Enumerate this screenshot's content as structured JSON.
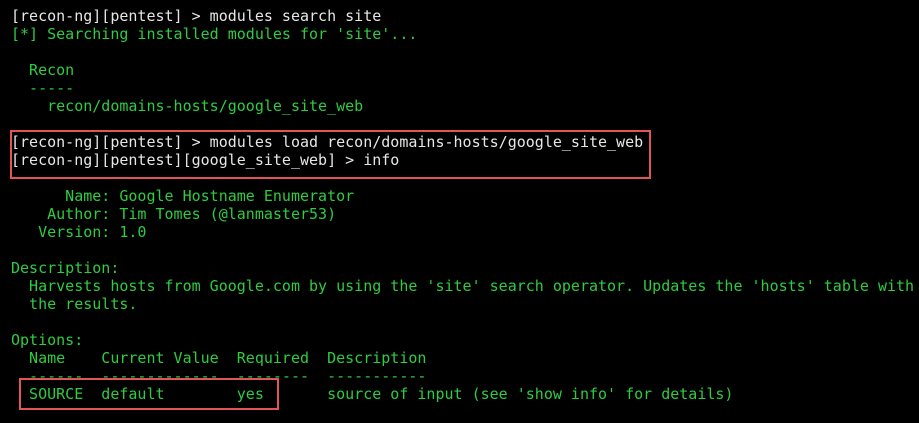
{
  "terminal": {
    "lines": [
      {
        "text": "[recon-ng][pentest] > modules search site",
        "style": "white"
      },
      {
        "text": "[*] Searching installed modules for 'site'...",
        "style": "green"
      },
      {
        "text": "",
        "style": "green"
      },
      {
        "text": "  Recon",
        "style": "green"
      },
      {
        "text": "  -----",
        "style": "green"
      },
      {
        "text": "    recon/domains-hosts/google_site_web",
        "style": "green"
      },
      {
        "text": "",
        "style": "green"
      },
      {
        "text": "[recon-ng][pentest] > modules load recon/domains-hosts/google_site_web",
        "style": "white"
      },
      {
        "text": "[recon-ng][pentest][google_site_web] > info",
        "style": "white"
      },
      {
        "text": "",
        "style": "green"
      },
      {
        "text": "      Name: Google Hostname Enumerator",
        "style": "green"
      },
      {
        "text": "    Author: Tim Tomes (@lanmaster53)",
        "style": "green"
      },
      {
        "text": "   Version: 1.0",
        "style": "green"
      },
      {
        "text": "",
        "style": "green"
      },
      {
        "text": "Description:",
        "style": "green"
      },
      {
        "text": "  Harvests hosts from Google.com by using the 'site' search operator. Updates the 'hosts' table with",
        "style": "green"
      },
      {
        "text": "  the results.",
        "style": "green"
      },
      {
        "text": "",
        "style": "green"
      },
      {
        "text": "Options:",
        "style": "green"
      },
      {
        "text": "  Name    Current Value  Required  Description",
        "style": "green"
      },
      {
        "text": "  ------  -------------  --------  -----------",
        "style": "green"
      },
      {
        "text": "  SOURCE  default        yes       source of input (see 'show info' for details)",
        "style": "green"
      }
    ]
  },
  "colors": {
    "background": "#000000",
    "prompt": "#e6e6e6",
    "output": "#2ecc40",
    "highlight": "#e05555"
  }
}
